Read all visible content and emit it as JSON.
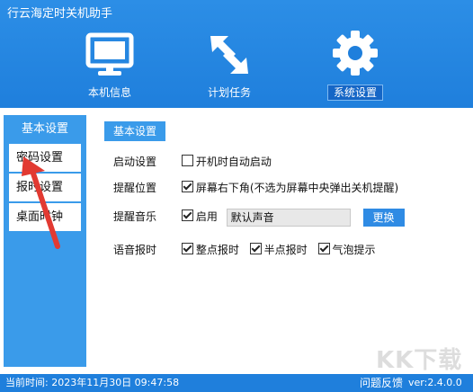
{
  "app": {
    "title": "行云海定时关机助手"
  },
  "nav": [
    {
      "label": "本机信息",
      "icon": "monitor-icon"
    },
    {
      "label": "计划任务",
      "icon": "arrows-icon"
    },
    {
      "label": "系统设置",
      "icon": "gear-icon",
      "active": true
    }
  ],
  "sidebar": {
    "header": "基本设置",
    "items": [
      {
        "label": "密码设置"
      },
      {
        "label": "报时设置"
      },
      {
        "label": "桌面时钟"
      }
    ]
  },
  "main": {
    "section_title": "基本设置",
    "startup": {
      "label": "启动设置",
      "option": "开机时自动启动",
      "checked": false
    },
    "reminder_pos": {
      "label": "提醒位置",
      "option": "屏幕右下角(不选为屏幕中央弹出关机提醒)",
      "checked": true
    },
    "reminder_music": {
      "label": "提醒音乐",
      "enable_label": "启用",
      "checked": true,
      "sound_value": "默认声音",
      "change_button": "更换"
    },
    "voice": {
      "label": "语音报时",
      "options": [
        {
          "label": "整点报时",
          "checked": true
        },
        {
          "label": "半点报时",
          "checked": true
        },
        {
          "label": "气泡提示",
          "checked": true
        }
      ]
    }
  },
  "status": {
    "time_text": "当前时间: 2023年11月30日  09:47:58",
    "feedback": "问题反馈",
    "version": "ver:2.4.0.0"
  },
  "watermark": "KK下载",
  "colors": {
    "accent": "#1f7fdc",
    "sidebar": "#3a9bea",
    "button": "#2f8be4"
  }
}
